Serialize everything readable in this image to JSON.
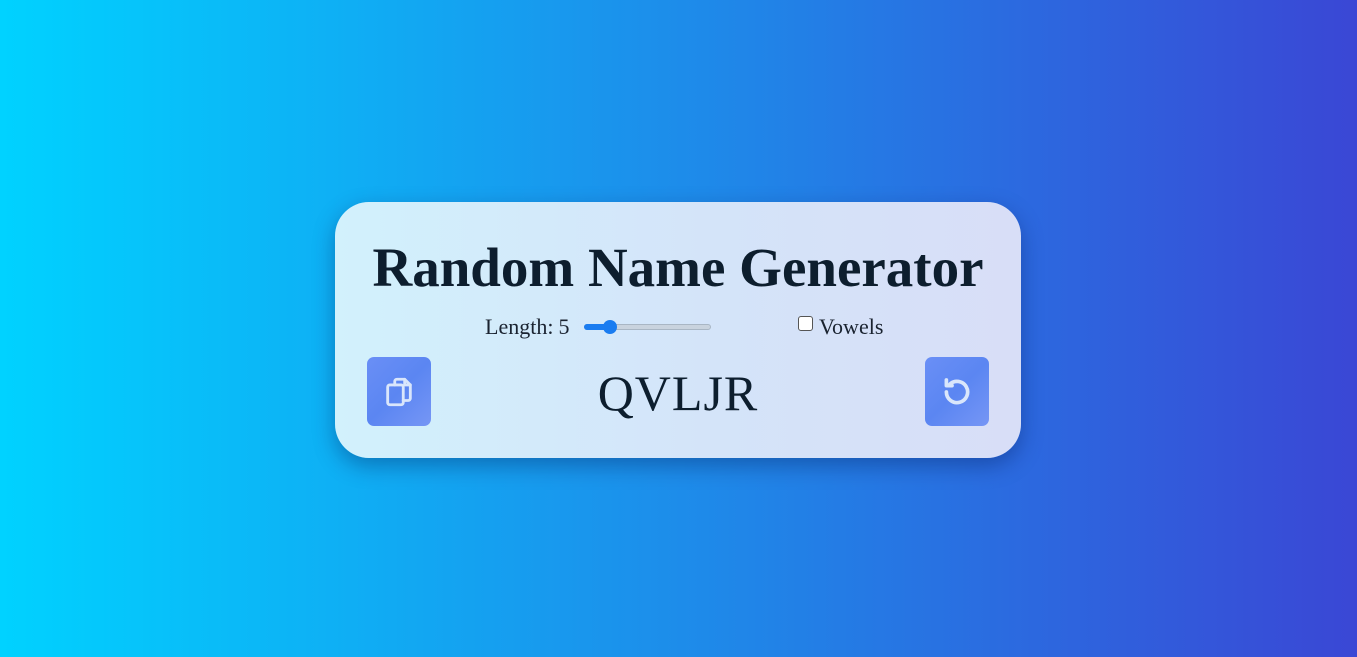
{
  "card": {
    "title": "Random Name Generator"
  },
  "controls": {
    "length_label": "Length:",
    "length_value": "5",
    "length_slider": {
      "value": 5,
      "min": 3,
      "max": 15
    },
    "vowels_label": "Vowels",
    "vowels_checked": false
  },
  "output": {
    "name": "QVLJR"
  },
  "buttons": {
    "copy_icon": "copy-icon",
    "refresh_icon": "refresh-icon"
  },
  "colors": {
    "background_start": "#00d2ff",
    "background_end": "#3a47d5",
    "button": "#6a8ff6",
    "slider_accent": "#1a7cf0"
  }
}
